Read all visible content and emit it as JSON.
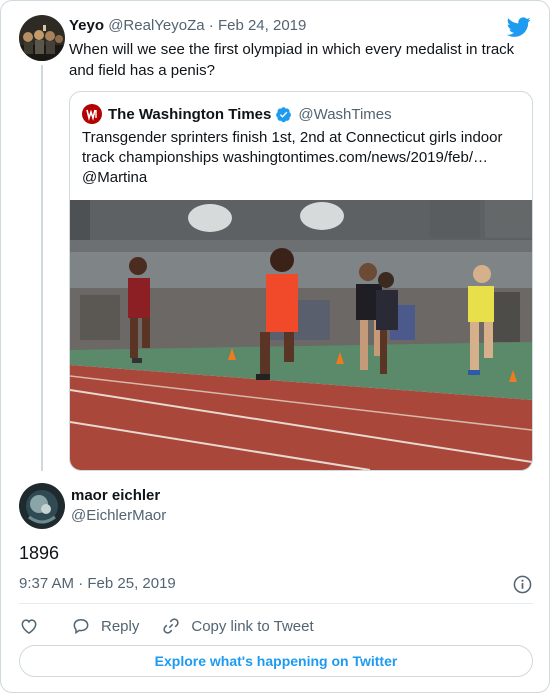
{
  "tweet": {
    "author_name": "Yeyo",
    "author_handle": "@RealYeyoZa",
    "separator": "·",
    "date": "Feb 24, 2019",
    "text": "When will we see the first olympiad in which every medalist in track and field has a penis?"
  },
  "quoted": {
    "name": "The Washington Times",
    "handle": "@WashTimes",
    "text": "Transgender sprinters finish 1st, 2nd at Connecticut girls indoor track championships washingtontimes.com/news/2019/feb/… @Martina",
    "media_icon": "track-race-photo"
  },
  "reply": {
    "author_name": "maor eichler",
    "author_handle": "@EichlerMaor",
    "text": "1896",
    "timestamp": "9:37 AM · Feb 25, 2019"
  },
  "actions": {
    "reply_label": "Reply",
    "copy_label": "Copy link to Tweet"
  },
  "explore_label": "Explore what's happening on Twitter",
  "colors": {
    "accent": "#1d9bf0",
    "muted": "#536471",
    "border": "#cfd9de",
    "verified": "#1d9bf0"
  }
}
